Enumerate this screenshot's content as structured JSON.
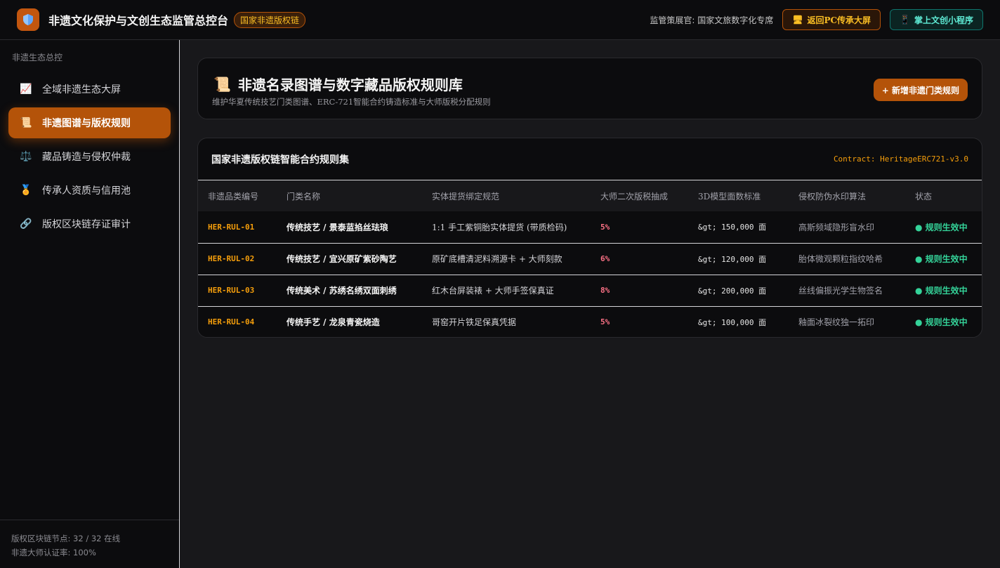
{
  "header": {
    "logo_icon": "shield-icon",
    "title": "非遗文化保护与文创生态监管总控台",
    "badge": "国家非遗版权链",
    "supervisor": "监管策展官: 国家文旅数字化专席",
    "pc_button": "返回PC传承大屏",
    "mini_button": "掌上文创小程序"
  },
  "sidebar": {
    "heading": "非遗生态总控",
    "items": [
      {
        "icon": "chart-icon",
        "label": "全域非遗生态大屏",
        "active": false
      },
      {
        "icon": "scroll-icon",
        "label": "非遗图谱与版权规则",
        "active": true
      },
      {
        "icon": "scales-icon",
        "label": "藏品铸造与侵权仲裁",
        "active": false
      },
      {
        "icon": "medal-icon",
        "label": "传承人资质与信用池",
        "active": false
      },
      {
        "icon": "link-icon",
        "label": "版权区块链存证审计",
        "active": false
      }
    ],
    "footer": {
      "nodes": "版权区块链节点: 32 / 32 在线",
      "rate": "非遗大师认证率: 100%"
    }
  },
  "page": {
    "title": "非遗名录图谱与数字藏品版权规则库",
    "subtitle": "维护华夏传统技艺门类图谱、ERC-721智能合约铸造标准与大师版税分配规则",
    "add_button": "+ 新增非遗门类规则"
  },
  "table": {
    "title": "国家非遗版权链智能合约规则集",
    "contract": "Contract: HeritageERC721-v3.0",
    "columns": [
      "非遗品类编号",
      "门类名称",
      "实体提货绑定规范",
      "大师二次版税抽成",
      "3D模型面数标准",
      "侵权防伪水印算法",
      "状态"
    ],
    "rows": [
      {
        "code": "HER-RUL-01",
        "name": "传统技艺 / 景泰蓝掐丝珐琅",
        "spec": "1:1 手工紫铜胎实体提货 (带质检码)",
        "royalty": "5%",
        "mesh": "&gt; 150,000 面",
        "watermark": "高斯频域隐形盲水印",
        "status": "● 规则生效中"
      },
      {
        "code": "HER-RUL-02",
        "name": "传统技艺 / 宜兴原矿紫砂陶艺",
        "spec": "原矿底槽清泥料溯源卡 + 大师刻款",
        "royalty": "6%",
        "mesh": "&gt; 120,000 面",
        "watermark": "胎体微观颗粒指纹哈希",
        "status": "● 规则生效中"
      },
      {
        "code": "HER-RUL-03",
        "name": "传统美术 / 苏绣名绣双面刺绣",
        "spec": "红木台屏装裱 + 大师手签保真证",
        "royalty": "8%",
        "mesh": "&gt; 200,000 面",
        "watermark": "丝线偏振光学生物签名",
        "status": "● 规则生效中"
      },
      {
        "code": "HER-RUL-04",
        "name": "传统手艺 / 龙泉青瓷烧造",
        "spec": "哥窑开片铁足保真凭据",
        "royalty": "5%",
        "mesh": "&gt; 100,000 面",
        "watermark": "釉面冰裂纹独一拓印",
        "status": "● 规则生效中"
      }
    ]
  },
  "colors": {
    "accent": "#b45309",
    "amber": "#f59e0b",
    "rose": "#fb7185",
    "green": "#34d399",
    "teal": "#5eead4"
  }
}
